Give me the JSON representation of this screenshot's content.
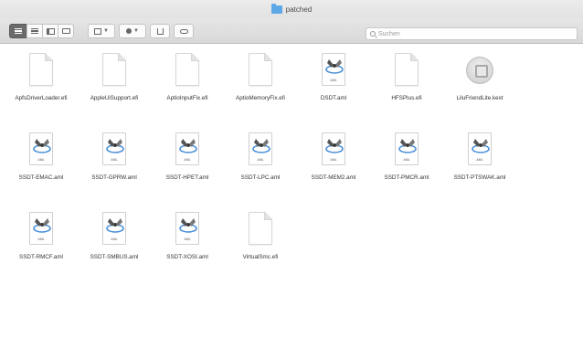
{
  "window": {
    "title": "patched"
  },
  "toolbar": {
    "view_buttons": [
      "icon-view",
      "list-view",
      "column-view",
      "gallery-view"
    ],
    "search_placeholder": "Suchen"
  },
  "files": [
    {
      "name": "ApfsDriverLoader.efi",
      "kind": "document"
    },
    {
      "name": "AppleUiSupport.efi",
      "kind": "document"
    },
    {
      "name": "AptioInputFix.efi",
      "kind": "document"
    },
    {
      "name": "AptioMemoryFix.efi",
      "kind": "document"
    },
    {
      "name": "DSDT.aml",
      "kind": "aml"
    },
    {
      "name": "HFSPlus.efi",
      "kind": "document"
    },
    {
      "name": "LiluFriendLite.kext",
      "kind": "kext"
    },
    {
      "name": "SSDT-EMAC.aml",
      "kind": "aml"
    },
    {
      "name": "SSDT-GPRW.aml",
      "kind": "aml"
    },
    {
      "name": "SSDT-HPET.aml",
      "kind": "aml"
    },
    {
      "name": "SSDT-LPC.aml",
      "kind": "aml"
    },
    {
      "name": "SSDT-MEM2.aml",
      "kind": "aml"
    },
    {
      "name": "SSDT-PMCR.aml",
      "kind": "aml"
    },
    {
      "name": "SSDT-PTSWAK.aml",
      "kind": "aml"
    },
    {
      "name": "SSDT-RMCF.aml",
      "kind": "aml"
    },
    {
      "name": "SSDT-SMBUS.aml",
      "kind": "aml"
    },
    {
      "name": "SSDT-XOSI.aml",
      "kind": "aml"
    },
    {
      "name": "VirtualSmc.efi",
      "kind": "document"
    }
  ],
  "icon_labels": {
    "aml": "AML"
  }
}
